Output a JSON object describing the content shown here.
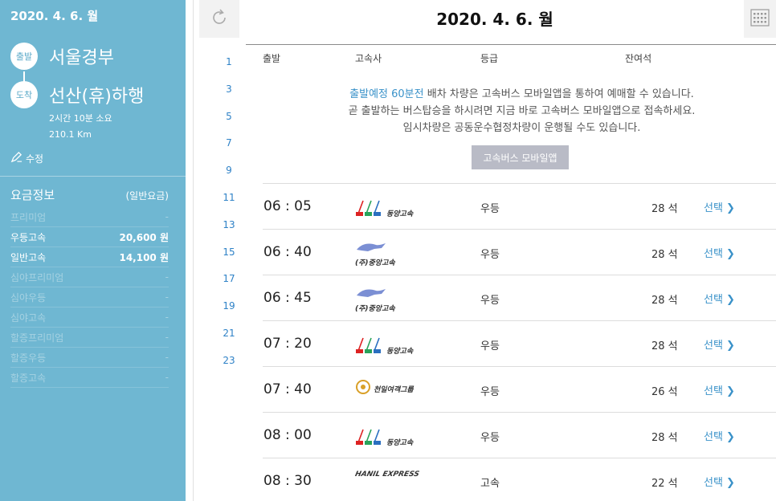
{
  "sidebar": {
    "date": "2020. 4. 6. 월",
    "depart_badge": "출발",
    "depart_name": "서울경부",
    "arrive_badge": "도착",
    "arrive_name": "선산(휴)하행",
    "duration": "2시간 10분 소요",
    "distance": "210.1 Km",
    "edit_label": "수정",
    "fare_title": "요금정보",
    "fare_type": "(일반요금)",
    "fares": [
      {
        "label": "프리미엄",
        "value": "-",
        "active": false
      },
      {
        "label": "우등고속",
        "value": "20,600 원",
        "active": true
      },
      {
        "label": "일반고속",
        "value": "14,100 원",
        "active": true
      },
      {
        "label": "심야프리미엄",
        "value": "-",
        "active": false
      },
      {
        "label": "심야우등",
        "value": "-",
        "active": false
      },
      {
        "label": "심야고속",
        "value": "-",
        "active": false
      },
      {
        "label": "할증프리미엄",
        "value": "-",
        "active": false
      },
      {
        "label": "할증우등",
        "value": "-",
        "active": false
      },
      {
        "label": "할증고속",
        "value": "-",
        "active": false
      }
    ]
  },
  "pager": [
    "1",
    "3",
    "5",
    "7",
    "9",
    "11",
    "13",
    "15",
    "17",
    "19",
    "21",
    "23"
  ],
  "header": {
    "title": "2020. 4. 6. 월",
    "col_depart": "출발",
    "col_company": "고속사",
    "col_grade": "등급",
    "col_seats": "잔여석"
  },
  "notice": {
    "hl": "출발예정 60분전",
    "line1_rest": " 배차 차량은 고속버스 모바일앱을 통하여 예매할 수 있습니다.",
    "line2": "곧 출발하는 버스탑승을 하시려면 지금 바로 고속버스 모바일앱으로 접속하세요.",
    "line3": "임시차량은 공동운수협정차량이 운행될 수도 있습니다.",
    "button": "고속버스 모바일앱"
  },
  "rows": [
    {
      "time": "06 : 05",
      "company": "동양고속",
      "logo": "dongyang",
      "grade": "우등",
      "seats": "28 석",
      "select": "선택"
    },
    {
      "time": "06 : 40",
      "company": "(주)중앙고속",
      "logo": "jungang",
      "grade": "우등",
      "seats": "28 석",
      "select": "선택"
    },
    {
      "time": "06 : 45",
      "company": "(주)중앙고속",
      "logo": "jungang",
      "grade": "우등",
      "seats": "28 석",
      "select": "선택"
    },
    {
      "time": "07 : 20",
      "company": "동양고속",
      "logo": "dongyang",
      "grade": "우등",
      "seats": "28 석",
      "select": "선택"
    },
    {
      "time": "07 : 40",
      "company": "천일여객그룹",
      "logo": "cheonil",
      "grade": "우등",
      "seats": "26 석",
      "select": "선택"
    },
    {
      "time": "08 : 00",
      "company": "동양고속",
      "logo": "dongyang",
      "grade": "우등",
      "seats": "28 석",
      "select": "선택"
    },
    {
      "time": "08 : 30",
      "company": "HANIL EXPRESS",
      "logo": "hanil",
      "grade": "고속",
      "seats": "22 석",
      "select": "선택"
    }
  ]
}
